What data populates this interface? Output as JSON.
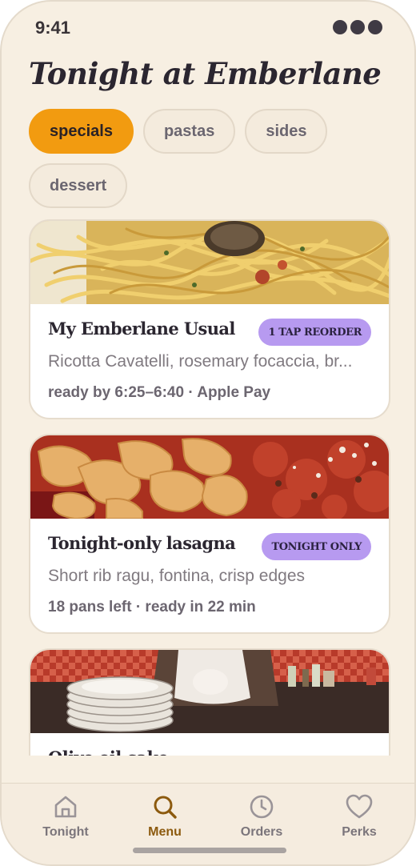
{
  "status": {
    "time": "9:41"
  },
  "header": {
    "title": "Tonight at Emberlane"
  },
  "chips": [
    {
      "label": "specials",
      "active": true
    },
    {
      "label": "pastas",
      "active": false
    },
    {
      "label": "sides",
      "active": false
    },
    {
      "label": "dessert",
      "active": false
    }
  ],
  "cards": [
    {
      "title": "My Emberlane Usual",
      "badge": "1 TAP REORDER",
      "description": "Ricotta Cavatelli, rosemary focaccia, br...",
      "meta": "ready by 6:25–6:40 · Apple Pay",
      "photo": "spaghetti-with-clams"
    },
    {
      "title": "Tonight-only lasagna",
      "badge": "TONIGHT ONLY",
      "description": "Short rib ragu, fontina, crisp edges",
      "meta": "18 pans left · ready in 22 min",
      "photo": "pappardelle-with-ragu"
    },
    {
      "title": "Olive oil cake",
      "photo": "restaurant-table-with-plates"
    }
  ],
  "tabbar": {
    "items": [
      {
        "label": "Tonight",
        "icon": "home-icon",
        "active": false
      },
      {
        "label": "Menu",
        "icon": "search-icon",
        "active": true
      },
      {
        "label": "Orders",
        "icon": "clock-icon",
        "active": false
      },
      {
        "label": "Perks",
        "icon": "heart-icon",
        "active": false
      }
    ]
  },
  "colors": {
    "background": "#f7efe2",
    "accent": "#f29b10",
    "badge": "#b79af0",
    "active_tab": "#8c5a0e",
    "text_dark": "#2b2630"
  }
}
